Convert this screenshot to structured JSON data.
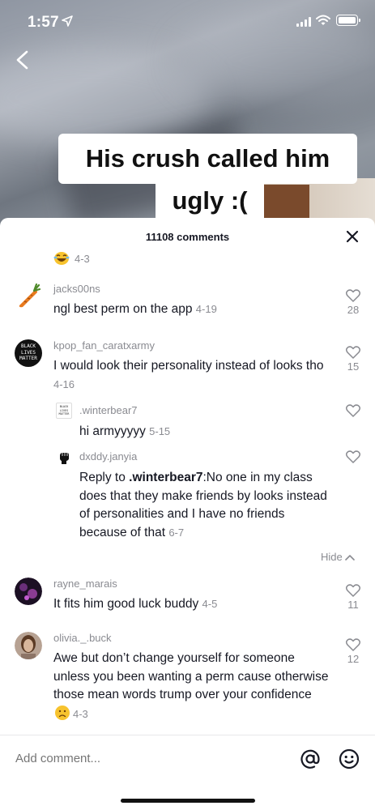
{
  "status_bar": {
    "time": "1:57"
  },
  "video": {
    "caption_line1": "His crush called him",
    "caption_line2": "ugly :("
  },
  "sheet": {
    "title": "11108 comments",
    "prev_tail_date": "4-3",
    "comments": [
      {
        "username": "jacks00ns",
        "text": "ngl best perm on the app",
        "date": "4-19",
        "likes": "28"
      },
      {
        "username": "kpop_fan_caratxarmy",
        "avatar_text": [
          "BLACK",
          "LIVES",
          "MATTER"
        ],
        "text": "I would look their personality instead of looks tho",
        "date": "4-16",
        "likes": "15"
      },
      {
        "username": ".winterbear7",
        "avatar_text": [
          "BLACK",
          "LIVES",
          "MATTER"
        ],
        "text": "hi armyyyyy",
        "date": "5-15"
      },
      {
        "username": "dxddy.janyia",
        "reply_prefix": "Reply to ",
        "reply_mention": ".winterbear7",
        "text": ":No one in my class does that they make friends by looks instead of personalities and I have no friends because of that",
        "date": "6-7"
      },
      {
        "username": "rayne_marais",
        "text": "It fits him good luck buddy",
        "date": "4-5",
        "likes": "11"
      },
      {
        "username": "olivia._.buck",
        "text": "Awe but don’t change yourself for someone unless you been wanting a perm cause otherwise those mean words trump over your confidence",
        "date": "4-3",
        "likes": "12"
      }
    ],
    "hide_label": "Hide"
  },
  "input": {
    "placeholder": "Add comment..."
  },
  "colors": {
    "text_primary": "#161823",
    "text_secondary": "#8a8b91",
    "divider": "#e8e8ea"
  }
}
